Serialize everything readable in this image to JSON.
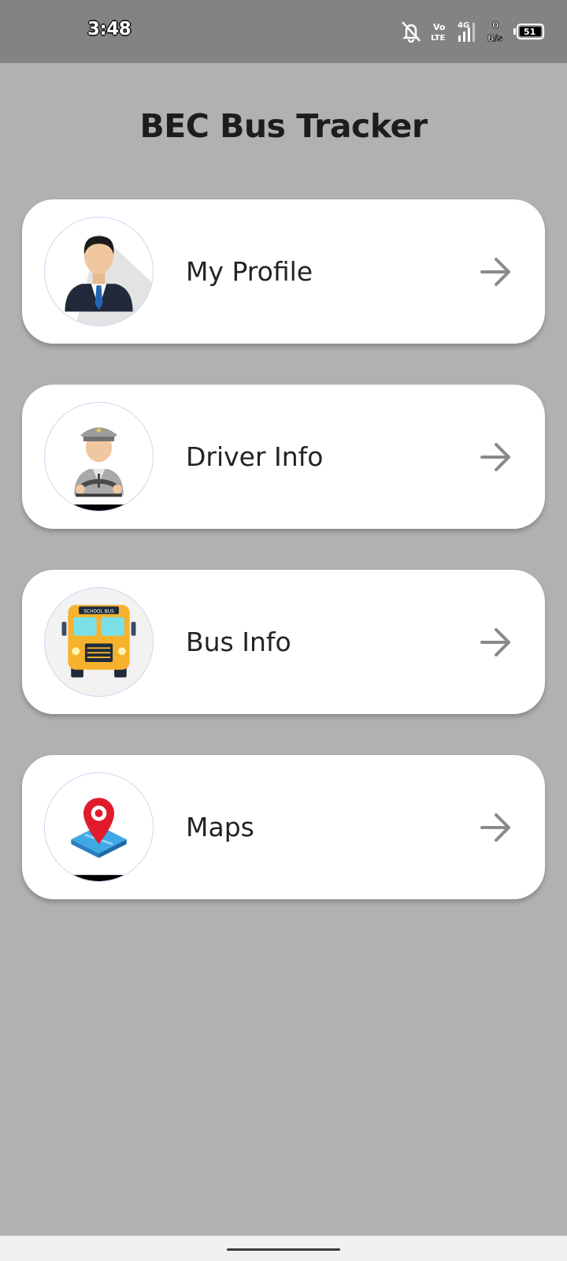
{
  "status_bar": {
    "time": "3:48",
    "icons": [
      "bell-off-icon",
      "volte-icon",
      "signal-4g-icon",
      "data-rate-icon",
      "battery-icon"
    ],
    "network_type": "4G",
    "volte_top": "Vo",
    "volte_bottom": "LTE",
    "data_rate_value": "0",
    "data_rate_unit": "B/s",
    "battery_level": "51"
  },
  "app": {
    "title": "BEC Bus Tracker"
  },
  "menu": {
    "items": [
      {
        "label": "My Profile",
        "icon": "profile-icon"
      },
      {
        "label": "Driver Info",
        "icon": "driver-icon"
      },
      {
        "label": "Bus Info",
        "icon": "bus-icon"
      },
      {
        "label": "Maps",
        "icon": "map-pin-icon"
      }
    ],
    "arrow_icon": "arrow-right-icon"
  },
  "bus_sign": "SCHOOL BUS",
  "colors": {
    "background": "#b1b1b1",
    "status_bar": "#838383",
    "card": "#ffffff",
    "arrow": "#8a8a8a",
    "bus_yellow": "#f6b22c",
    "pin_red": "#e11b2b",
    "map_blue": "#3fa8e6"
  }
}
